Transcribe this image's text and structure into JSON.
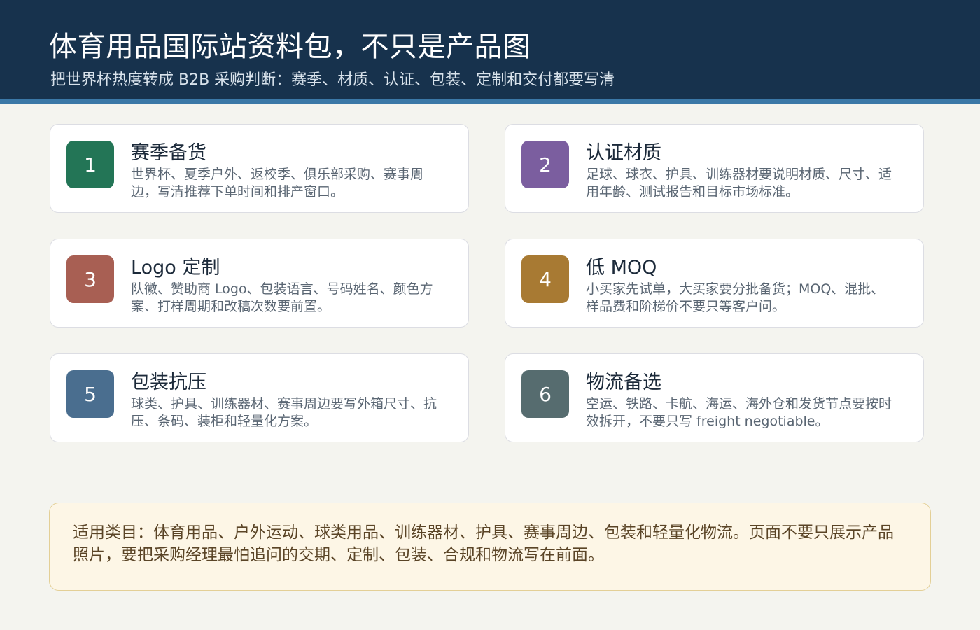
{
  "header": {
    "title": "体育用品国际站资料包，不只是产品图",
    "subtitle": "把世界杯热度转成 B2B 采购判断：赛季、材质、认证、包装、定制和交付都要写清"
  },
  "cards": [
    {
      "number": "1",
      "title": "赛季备货",
      "description": "世界杯、夏季户外、返校季、俱乐部采购、赛事周边，写清推荐下单时间和排产窗口。",
      "color": "#237556"
    },
    {
      "number": "2",
      "title": "认证材质",
      "description": "足球、球衣、护具、训练器材要说明材质、尺寸、适用年龄、测试报告和目标市场标准。",
      "color": "#7b5e9f"
    },
    {
      "number": "3",
      "title": "Logo 定制",
      "description": "队徽、赞助商 Logo、包装语言、号码姓名、颜色方案、打样周期和改稿次数要前置。",
      "color": "#a85f53"
    },
    {
      "number": "4",
      "title": "低 MOQ",
      "description": "小买家先试单，大买家要分批备货；MOQ、混批、样品费和阶梯价不要只等客户问。",
      "color": "#a87a33"
    },
    {
      "number": "5",
      "title": "包装抗压",
      "description": "球类、护具、训练器材、赛事周边要写外箱尺寸、抗压、条码、装柜和轻量化方案。",
      "color": "#4a6e8f"
    },
    {
      "number": "6",
      "title": "物流备选",
      "description": "空运、铁路、卡航、海运、海外仓和发货节点要按时效拆开，不要只写 freight negotiable。",
      "color": "#566c6f"
    }
  ],
  "note": {
    "text": "适用类目：体育用品、户外运动、球类用品、训练器材、护具、赛事周边、包装和轻量化物流。页面不要只展示产品照片，要把采购经理最怕追问的交期、定制、包装、合规和物流写在前面。"
  }
}
